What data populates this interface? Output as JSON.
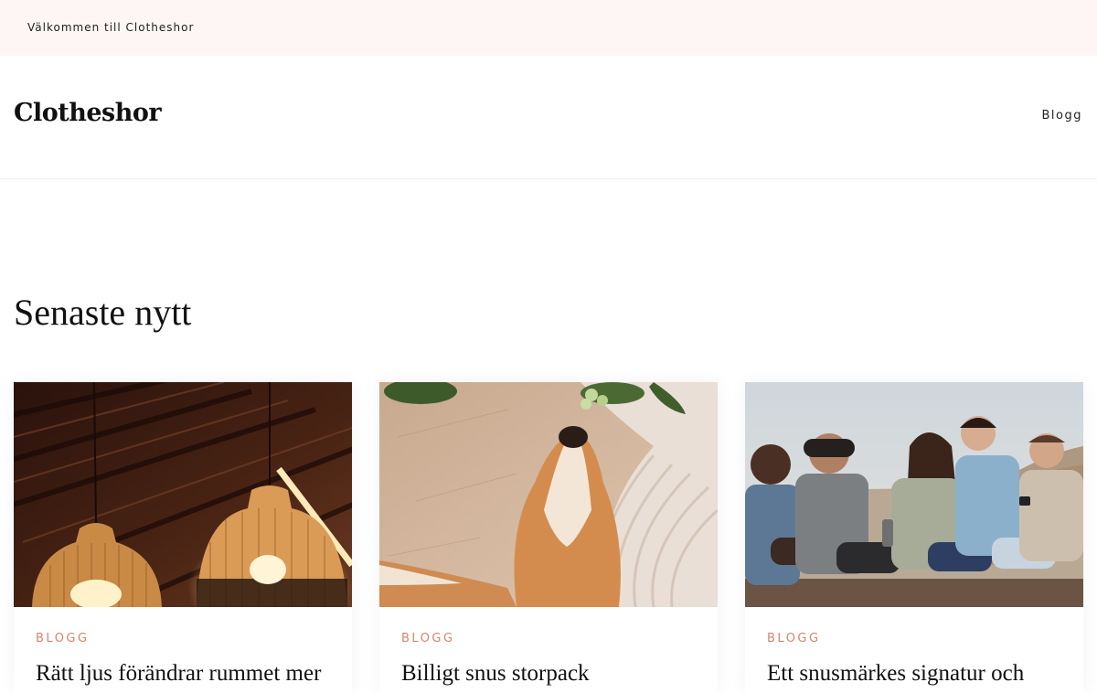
{
  "topbar": {
    "welcome_text": "Välkommen till Clotheshor"
  },
  "header": {
    "logo": "Clotheshor",
    "nav": [
      {
        "label": "Blogg"
      }
    ]
  },
  "main": {
    "section_title": "Senaste nytt",
    "posts": [
      {
        "category": "BLOGG",
        "title": "Rätt ljus förändrar rummet mer",
        "image": "rattan-pendant-lamps-photo"
      },
      {
        "category": "BLOGG",
        "title": "Billigt snus storpack",
        "image": "dog-on-blanket-photo"
      },
      {
        "category": "BLOGG",
        "title": "Ett snusmärkes signatur och",
        "image": "friends-group-photo"
      }
    ]
  },
  "colors": {
    "topbar_bg": "#fdf6f4",
    "category_accent": "#d4856d",
    "text": "#111111"
  }
}
